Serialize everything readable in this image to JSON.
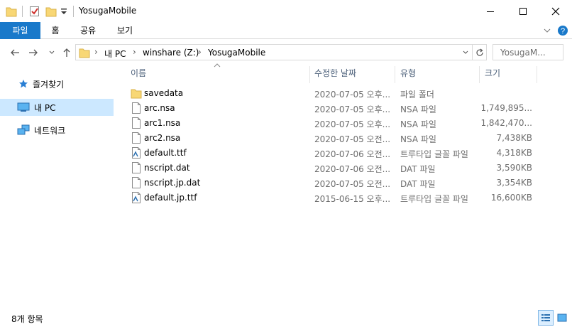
{
  "window": {
    "title": "YosugaMobile"
  },
  "ribbon": {
    "tabs": [
      "파일",
      "홈",
      "공유",
      "보기"
    ]
  },
  "address": {
    "crumbs": [
      "내 PC",
      "winshare (Z:)",
      "YosugaMobile"
    ],
    "search_placeholder": "YosugaM..."
  },
  "nav": {
    "items": [
      {
        "label": "즐겨찾기",
        "icon": "star-icon"
      },
      {
        "label": "내 PC",
        "icon": "computer-icon"
      },
      {
        "label": "네트워크",
        "icon": "network-icon"
      }
    ]
  },
  "columns": {
    "name": "이름",
    "date": "수정한 날짜",
    "type": "유형",
    "size": "크기"
  },
  "files": [
    {
      "name": "savedata",
      "date": "2020-07-05 오후...",
      "type": "파일 폴더",
      "size": "",
      "icon": "folder-icon"
    },
    {
      "name": "arc.nsa",
      "date": "2020-07-05 오후...",
      "type": "NSA 파일",
      "size": "1,749,895...",
      "icon": "file-icon"
    },
    {
      "name": "arc1.nsa",
      "date": "2020-07-05 오후...",
      "type": "NSA 파일",
      "size": "1,842,470...",
      "icon": "file-icon"
    },
    {
      "name": "arc2.nsa",
      "date": "2020-07-05 오전...",
      "type": "NSA 파일",
      "size": "7,438KB",
      "icon": "file-icon"
    },
    {
      "name": "default.ttf",
      "date": "2020-07-06 오전...",
      "type": "트루타입 글꼴 파일",
      "size": "4,318KB",
      "icon": "font-file-icon"
    },
    {
      "name": "nscript.dat",
      "date": "2020-07-06 오전...",
      "type": "DAT 파일",
      "size": "3,590KB",
      "icon": "file-icon"
    },
    {
      "name": "nscript.jp.dat",
      "date": "2020-07-05 오전...",
      "type": "DAT 파일",
      "size": "3,354KB",
      "icon": "file-icon"
    },
    {
      "name": "default.jp.ttf",
      "date": "2015-06-15 오후...",
      "type": "트루타입 글꼴 파일",
      "size": "16,600KB",
      "icon": "font-file-icon"
    }
  ],
  "status": {
    "count": "8개 항목"
  },
  "colors": {
    "accent": "#1979ca",
    "selected_bg": "#cce8ff",
    "folder": "#f8d775"
  }
}
